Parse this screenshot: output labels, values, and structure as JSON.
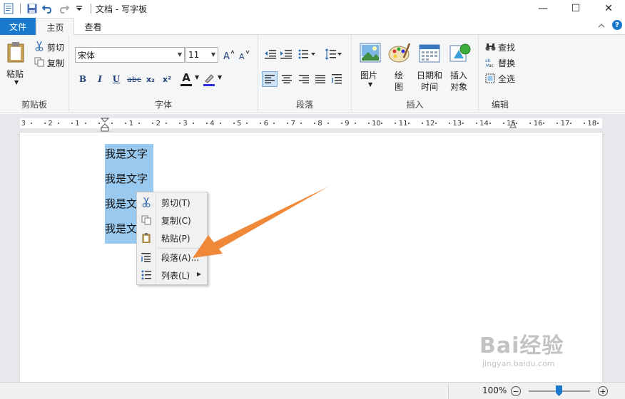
{
  "window": {
    "title": "文档 - 写字板",
    "minimize": "—",
    "maximize": "☐",
    "close": "✕"
  },
  "tabs": {
    "file": "文件",
    "home": "主页",
    "view": "查看",
    "collapse": "^",
    "help": "?"
  },
  "clipboard": {
    "paste": "粘贴",
    "cut": "剪切",
    "copy": "复制",
    "label": "剪贴板"
  },
  "font": {
    "family": "宋体",
    "size": "11",
    "bold": "B",
    "italic": "I",
    "underline": "U",
    "strike": "abc",
    "sub": "x₂",
    "sup": "x²",
    "color_letter": "A",
    "label": "字体"
  },
  "paragraph": {
    "label": "段落"
  },
  "insert": {
    "picture": "图片",
    "paint1": "绘",
    "paint2": "图",
    "datetime1": "日期和",
    "datetime2": "时间",
    "object1": "插入",
    "object2": "对象",
    "label": "插入"
  },
  "editing": {
    "find": "查找",
    "replace": "替换",
    "select_all": "全选",
    "label": "编辑"
  },
  "ruler": [
    "3",
    "2",
    "1",
    "1",
    "2",
    "3",
    "4",
    "5",
    "6",
    "7",
    "8",
    "9",
    "10",
    "11",
    "12",
    "13",
    "14",
    "15",
    "16",
    "17",
    "18"
  ],
  "document": {
    "lines": [
      "我是文字",
      "我是文字",
      "我是文字",
      "我是文字"
    ]
  },
  "context_menu": {
    "cut": "剪切(T)",
    "copy": "复制(C)",
    "paste": "粘贴(P)",
    "paragraph": "段落(A)...",
    "list": "列表(L)"
  },
  "status": {
    "zoom": "100%",
    "zoom_level": 1.0
  },
  "watermark": {
    "brand": "Bai经验",
    "url": "jingyan.baidu.com"
  },
  "colors": {
    "accent": "#1979ca",
    "selection": "#99c9ef",
    "arrow": "#f0883a"
  }
}
